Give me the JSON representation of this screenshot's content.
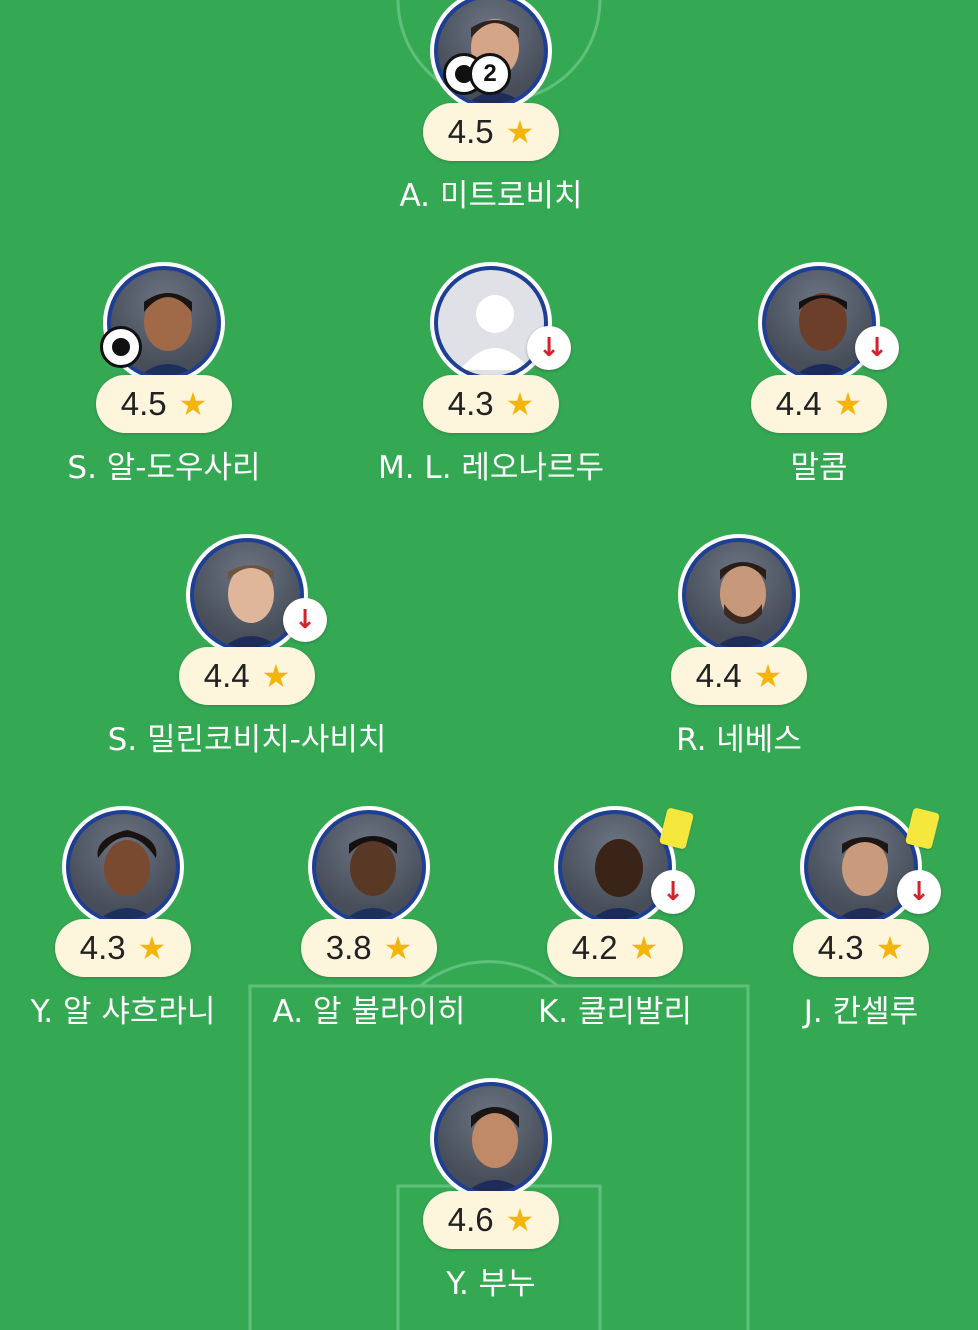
{
  "colors": {
    "pitch": "#35a854",
    "line": "#5ec07a",
    "rating_bg": "#fdf5dc",
    "star": "#f3b50b",
    "avatar_ring": "#1e3f94",
    "sub_arrow": "#d5232b",
    "yellow_card": "#f6e73c"
  },
  "players": [
    {
      "id": "mitrovic",
      "name": "A. 미트로비치",
      "rating": "4.5",
      "goals": "2",
      "photo": "player-photo",
      "badges": [
        "soccer-ball-icon",
        "goal-count-badge"
      ]
    },
    {
      "id": "aldawsari",
      "name": "S. 알-도우사리",
      "rating": "4.5",
      "photo": "player-photo",
      "badges": [
        "soccer-ball-icon"
      ]
    },
    {
      "id": "leonardo",
      "name": "M. L. 레오나르두",
      "rating": "4.3",
      "photo": "placeholder-avatar",
      "badges": [
        "sub-off-arrow-icon"
      ]
    },
    {
      "id": "malcom",
      "name": "말콤",
      "rating": "4.4",
      "photo": "player-photo",
      "badges": [
        "sub-off-arrow-icon"
      ]
    },
    {
      "id": "milinkovic",
      "name": "S. 밀린코비치-사비치",
      "rating": "4.4",
      "photo": "player-photo",
      "badges": [
        "sub-off-arrow-icon"
      ]
    },
    {
      "id": "neves",
      "name": "R. 네베스",
      "rating": "4.4",
      "photo": "player-photo",
      "badges": []
    },
    {
      "id": "alshahrani",
      "name": "Y. 알 샤흐라니",
      "rating": "4.3",
      "photo": "player-photo",
      "badges": []
    },
    {
      "id": "albulayhi",
      "name": "A. 알 불라이히",
      "rating": "3.8",
      "photo": "player-photo",
      "badges": []
    },
    {
      "id": "koulibaly",
      "name": "K. 쿨리발리",
      "rating": "4.2",
      "photo": "player-photo",
      "badges": [
        "yellow-card-icon",
        "sub-off-arrow-icon"
      ]
    },
    {
      "id": "cancelo",
      "name": "J. 칸셀루",
      "rating": "4.3",
      "photo": "player-photo",
      "badges": [
        "yellow-card-icon",
        "sub-off-arrow-icon"
      ]
    },
    {
      "id": "bounou",
      "name": "Y. 부누",
      "rating": "4.6",
      "photo": "player-photo",
      "badges": []
    }
  ],
  "icons": {
    "star": "★",
    "sub_off": "↓"
  }
}
